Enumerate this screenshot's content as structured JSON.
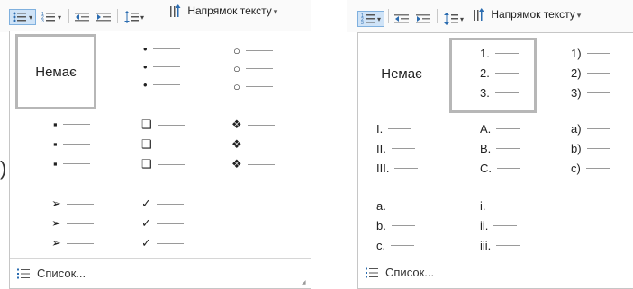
{
  "left": {
    "toolbar": {
      "direction_label": "Напрямок тексту",
      "dropdown_arrow": "▾"
    },
    "none_label": "Немає",
    "footer_label": "Список..."
  },
  "right": {
    "toolbar": {
      "direction_label": "Напрямок тексту",
      "dropdown_arrow": "▾"
    },
    "none_label": "Немає",
    "footer_label": "Список...",
    "lists": {
      "arabic_paren": [
        "1)",
        "2)",
        "3)"
      ],
      "arabic_dot": [
        "1.",
        "2.",
        "3."
      ],
      "roman_upper": [
        "I.",
        "II.",
        "III."
      ],
      "alpha_upper": [
        "A.",
        "B.",
        "C."
      ],
      "alpha_paren": [
        "a)",
        "b)",
        "c)"
      ],
      "alpha_lower": [
        "a.",
        "b.",
        "c."
      ],
      "roman_lower": [
        "i.",
        "ii.",
        "iii."
      ]
    }
  },
  "bullets": {
    "dot": "•",
    "circle": "○",
    "square": "▪",
    "box": "❑",
    "diamond": "❖",
    "arrow": "➢",
    "check": "✓"
  }
}
